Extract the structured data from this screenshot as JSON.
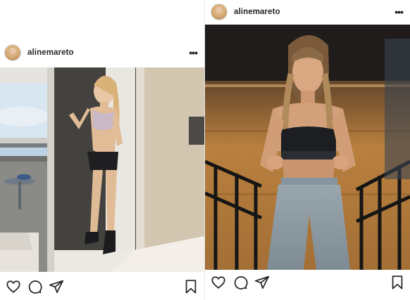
{
  "posts": [
    {
      "username": "alinemareto",
      "more_label": "•••",
      "photo_alt": "",
      "icons": [
        "heart-icon",
        "comment-icon",
        "share-icon",
        "bookmark-icon"
      ]
    },
    {
      "username": "alinemareto",
      "more_label": "•••",
      "photo_alt": "",
      "icons": [
        "heart-icon",
        "comment-icon",
        "share-icon",
        "bookmark-icon"
      ]
    }
  ],
  "colors": {
    "text": "#262626",
    "background": "#ffffff",
    "border": "#dbdbdb"
  }
}
